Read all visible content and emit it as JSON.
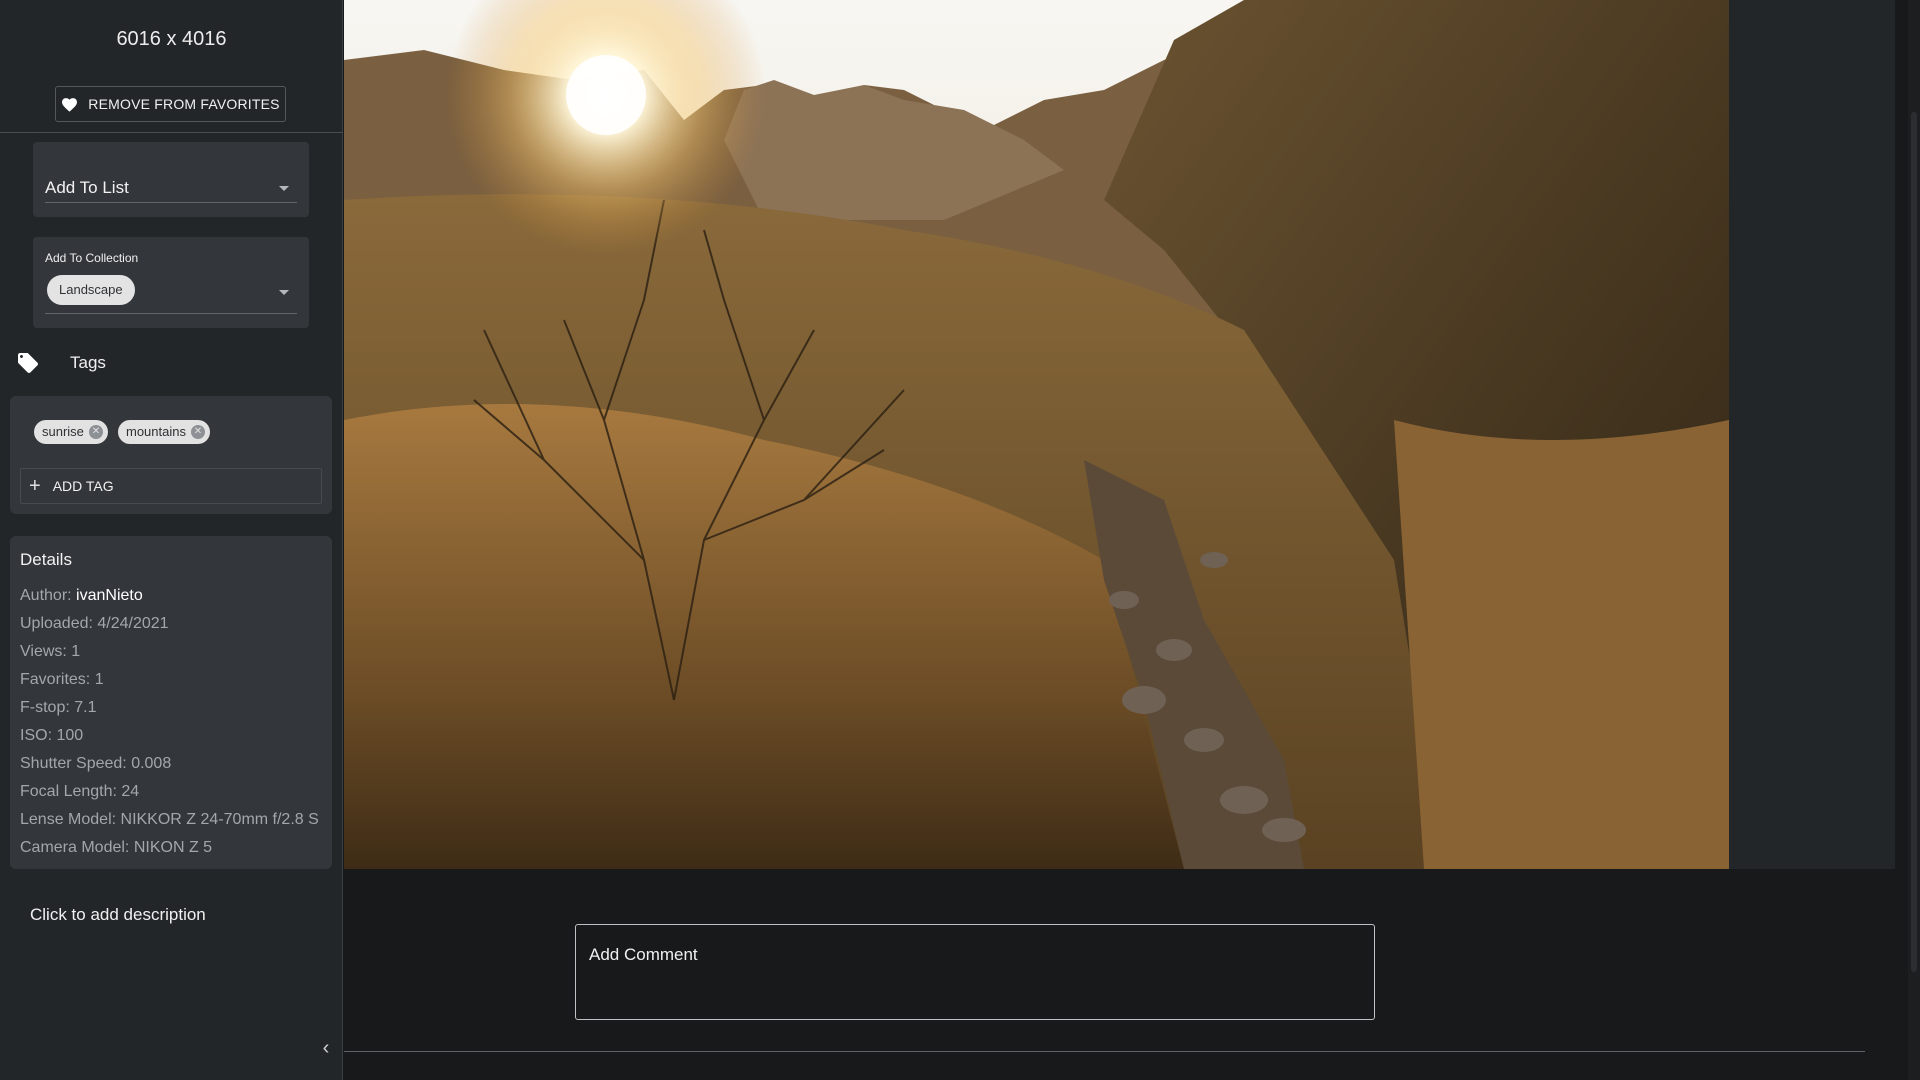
{
  "image": {
    "dimensions": "6016 x 4016",
    "favorite_button_label": "REMOVE FROM FAVORITES",
    "alt": "Desert mountain trail at sunrise"
  },
  "list_select": {
    "value": "Add To List"
  },
  "collection_select": {
    "label": "Add To Collection",
    "chip": "Landscape"
  },
  "tags": {
    "header": "Tags",
    "items": [
      "sunrise",
      "mountains"
    ],
    "add_label": "ADD TAG"
  },
  "details": {
    "title": "Details",
    "author_label": "Author:",
    "author": "ivanNieto",
    "uploaded": "Uploaded: 4/24/2021",
    "views": "Views: 1",
    "favorites": "Favorites: 1",
    "fstop": "F-stop: 7.1",
    "iso": "ISO: 100",
    "shutter": "Shutter Speed: 0.008",
    "focal": "Focal Length: 24",
    "lens": "Lense Model: NIKKOR Z 24-70mm f/2.8 S",
    "camera": "Camera Model: NIKON Z 5"
  },
  "description_prompt": "Click to add description",
  "comment": {
    "placeholder": "Add Comment"
  },
  "icons": {
    "favorite": "heart-icon",
    "tags": "tag-icon",
    "tag_remove": "close-circle-icon",
    "add_tag": "plus-icon",
    "collapse": "chevron-left-icon"
  },
  "colors": {
    "sidebar_bg": "#232629",
    "card_bg": "#33373b",
    "page_bg": "#18191a"
  }
}
